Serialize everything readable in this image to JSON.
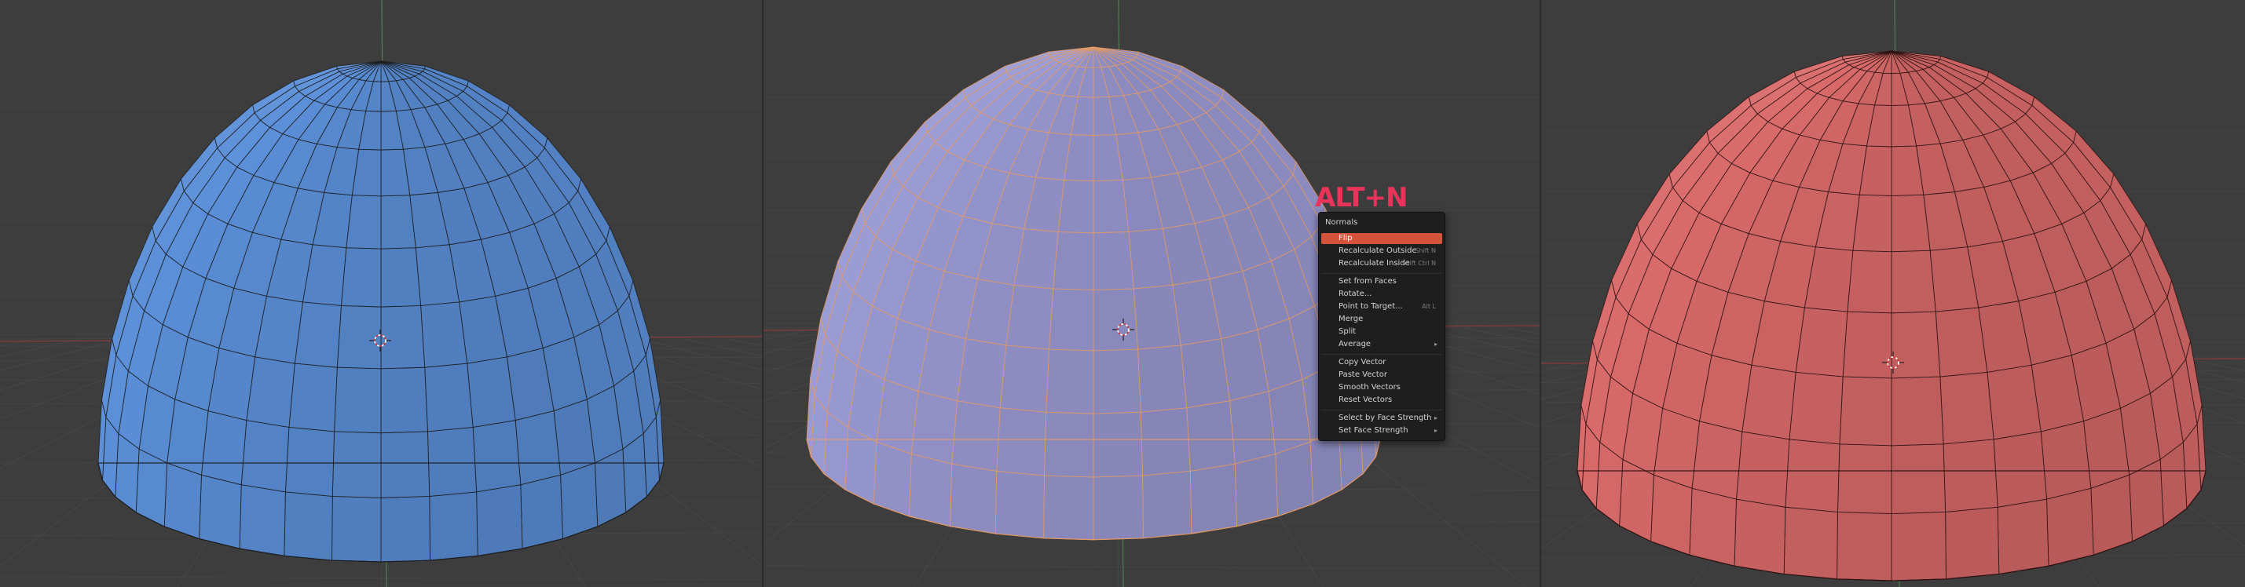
{
  "viewports": [
    {
      "name": "blue-dome-viewport",
      "fill": "#5b8fd8",
      "wire": "#1b1b1b"
    },
    {
      "name": "selected-dome-viewport",
      "fill": "#9a9ad4",
      "wire": "#e59a62"
    },
    {
      "name": "red-dome-viewport",
      "fill": "#d96a6a",
      "wire": "#2a1010"
    }
  ],
  "colors": {
    "background": "#3d3d3d",
    "grid": "#474747",
    "axis_x": "#8a3a3a",
    "axis_y": "#4f7f4f",
    "menu_highlight": "#d4533a",
    "hotkey": "#e8345a"
  },
  "icons": [
    "3d-cursor-icon"
  ],
  "hotkey_label": "ALT+N",
  "menu": {
    "title": "Normals",
    "items": [
      {
        "label": "Flip",
        "shortcut": "",
        "submenu": false,
        "active": true
      },
      {
        "label": "Recalculate Outside",
        "shortcut": "Shift N",
        "submenu": false,
        "active": false
      },
      {
        "label": "Recalculate Inside",
        "shortcut": "Shift Ctrl N",
        "submenu": false,
        "active": false
      },
      {
        "separator": true
      },
      {
        "label": "Set from Faces",
        "shortcut": "",
        "submenu": false,
        "active": false
      },
      {
        "label": "Rotate...",
        "shortcut": "",
        "submenu": false,
        "active": false
      },
      {
        "label": "Point to Target...",
        "shortcut": "Alt L",
        "submenu": false,
        "active": false
      },
      {
        "label": "Merge",
        "shortcut": "",
        "submenu": false,
        "active": false
      },
      {
        "label": "Split",
        "shortcut": "",
        "submenu": false,
        "active": false
      },
      {
        "label": "Average",
        "shortcut": "",
        "submenu": true,
        "active": false
      },
      {
        "separator": true
      },
      {
        "label": "Copy Vector",
        "shortcut": "",
        "submenu": false,
        "active": false
      },
      {
        "label": "Paste Vector",
        "shortcut": "",
        "submenu": false,
        "active": false
      },
      {
        "label": "Smooth Vectors",
        "shortcut": "",
        "submenu": false,
        "active": false
      },
      {
        "label": "Reset Vectors",
        "shortcut": "",
        "submenu": false,
        "active": false
      },
      {
        "separator": true
      },
      {
        "label": "Select by Face Strength",
        "shortcut": "",
        "submenu": true,
        "active": false
      },
      {
        "label": "Set Face Strength",
        "shortcut": "",
        "submenu": true,
        "active": false
      }
    ]
  }
}
